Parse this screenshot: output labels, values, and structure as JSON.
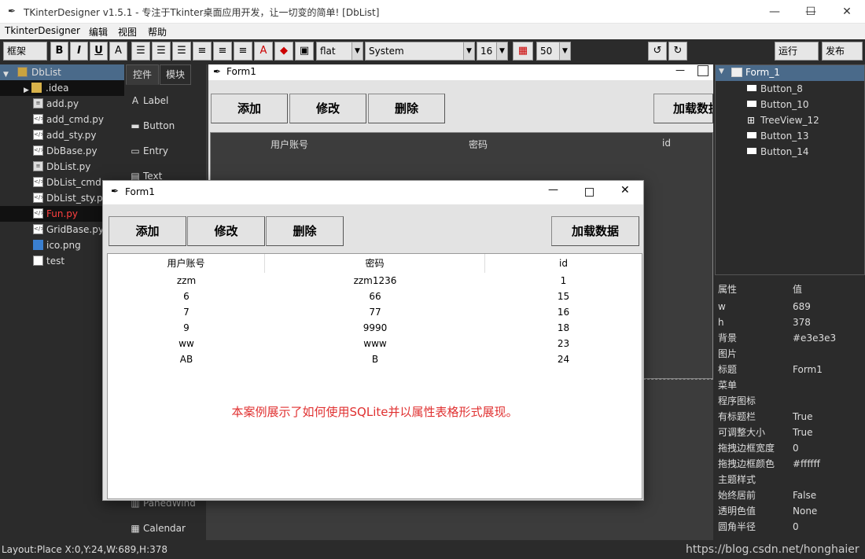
{
  "window": {
    "title": "TKinterDesigner v1.5.1 - 专注于Tkinter桌面应用开发，让一切变的简单!    [DbList]",
    "min": "—",
    "max": "☐",
    "close": "✕"
  },
  "menu": [
    "TkinterDesigner",
    "编辑",
    "视图",
    "帮助"
  ],
  "toolbar": {
    "frame_label": "框架",
    "bold": "B",
    "italic": "I",
    "underline": "U",
    "font_a": "A",
    "relief": "flat",
    "font": "System",
    "size": "16",
    "grid_value": "50",
    "run": "运行",
    "publish": "发布"
  },
  "project_tree": {
    "root": "DbList",
    "items": [
      {
        "name": ".idea",
        "type": "folder"
      },
      {
        "name": "add.py",
        "type": "grid"
      },
      {
        "name": "add_cmd.py",
        "type": "code"
      },
      {
        "name": "add_sty.py",
        "type": "code"
      },
      {
        "name": "DbBase.py",
        "type": "code"
      },
      {
        "name": "DbList.py",
        "type": "grid"
      },
      {
        "name": "DbList_cmd.",
        "type": "code"
      },
      {
        "name": "DbList_sty.py",
        "type": "code"
      },
      {
        "name": "Fun.py",
        "type": "code",
        "highlight": true
      },
      {
        "name": "GridBase.py",
        "type": "code"
      },
      {
        "name": "ico.png",
        "type": "image"
      },
      {
        "name": "test",
        "type": "file"
      }
    ]
  },
  "widget_panel": {
    "tabs": [
      "控件",
      "模块"
    ],
    "widgets": [
      "Label",
      "Button",
      "Entry",
      "Text"
    ],
    "bottom_widgets": [
      "PanedWind",
      "Calendar"
    ]
  },
  "design_form": {
    "title": "Form1",
    "buttons": [
      "添加",
      "修改",
      "删除",
      "加载数据"
    ],
    "columns": [
      "用户账号",
      "密码",
      "id"
    ]
  },
  "object_tree": {
    "root": "Form_1",
    "items": [
      "Button_8",
      "Button_10",
      "TreeView_12",
      "Button_13",
      "Button_14"
    ]
  },
  "properties": {
    "header_key": "属性",
    "header_val": "值",
    "rows": [
      {
        "k": "w",
        "v": "689"
      },
      {
        "k": "h",
        "v": "378"
      },
      {
        "k": "背景",
        "v": "#e3e3e3"
      },
      {
        "k": "图片",
        "v": ""
      },
      {
        "k": "标题",
        "v": "Form1"
      },
      {
        "k": "菜单",
        "v": ""
      },
      {
        "k": "程序图标",
        "v": ""
      },
      {
        "k": "有标题栏",
        "v": "True"
      },
      {
        "k": "可调整大小",
        "v": "True"
      },
      {
        "k": "拖拽边框宽度",
        "v": "0"
      },
      {
        "k": "拖拽边框颜色",
        "v": "#ffffff"
      },
      {
        "k": "主题样式",
        "v": ""
      },
      {
        "k": "始终居前",
        "v": "False"
      },
      {
        "k": "透明色值",
        "v": "None"
      },
      {
        "k": "圆角半径",
        "v": "0"
      }
    ]
  },
  "status": "Layout:Place  X:0,Y:24,W:689,H:378",
  "watermark": "https://blog.csdn.net/honghaier",
  "popup": {
    "title": "Form1",
    "buttons": [
      "添加",
      "修改",
      "删除",
      "加载数据"
    ],
    "columns": [
      "用户账号",
      "密码",
      "id"
    ],
    "rows": [
      [
        "zzm",
        "zzm1236",
        "1"
      ],
      [
        "6",
        "66",
        "15"
      ],
      [
        "7",
        "77",
        "16"
      ],
      [
        "9",
        "9990",
        "18"
      ],
      [
        "ww",
        "www",
        "23"
      ],
      [
        "AB",
        "B",
        "24"
      ]
    ],
    "note": "本案例展示了如何使用SQLite并以属性表格形式展现。"
  }
}
